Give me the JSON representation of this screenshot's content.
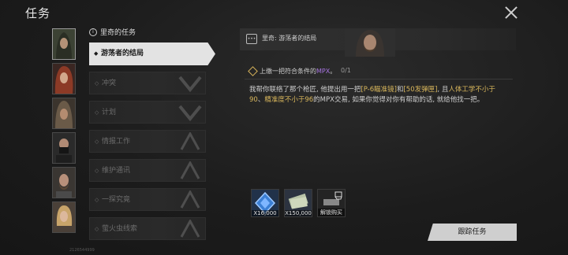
{
  "header": {
    "title": "任务"
  },
  "group_label": "里奇的任务",
  "quests": [
    {
      "label": "游荡者的结局",
      "state": "active"
    },
    {
      "label": "冲突",
      "state": "locked"
    },
    {
      "label": "计划",
      "state": "locked"
    },
    {
      "label": "情报工作",
      "state": "locked"
    },
    {
      "label": "维护通讯",
      "state": "locked"
    },
    {
      "label": "一探究竟",
      "state": "locked"
    },
    {
      "label": "萤火虫线索",
      "state": "locked"
    }
  ],
  "dialog": {
    "title": "里奇: 游荡者的结局",
    "objective_prefix": "上缴一把符合条件的",
    "objective_highlight": "MPX",
    "objective_suffix": "。",
    "progress": "0/1",
    "body": [
      {
        "t": "我帮你联络了那个枪匠, 他提出用一把",
        "hl": false
      },
      {
        "t": "[P-6瞄准镜]",
        "hl": true
      },
      {
        "t": "和",
        "hl": false
      },
      {
        "t": "[50发弹匣]",
        "hl": true
      },
      {
        "t": ", 且",
        "hl": false
      },
      {
        "t": "人体工学不小于90",
        "hl": true
      },
      {
        "t": "、",
        "hl": false
      },
      {
        "t": "精准度不小于96",
        "hl": true
      },
      {
        "t": "的MPX交易, 如果你觉得对你有帮助的话, 就给他找一把。",
        "hl": false
      }
    ]
  },
  "rewards": [
    {
      "icon": "xp-crystal-icon",
      "count": "X16,000"
    },
    {
      "icon": "cash-bundle-icon",
      "count": "X150,000"
    },
    {
      "icon": "unlock-purchase-icon",
      "count": "解锁购买"
    }
  ],
  "track_button": "跟踪任务",
  "uid": "2126544999",
  "colors": {
    "highlight_yellow": "#d9b75c",
    "highlight_purple": "#a774e0",
    "active_bg": "#e3e3e3"
  }
}
